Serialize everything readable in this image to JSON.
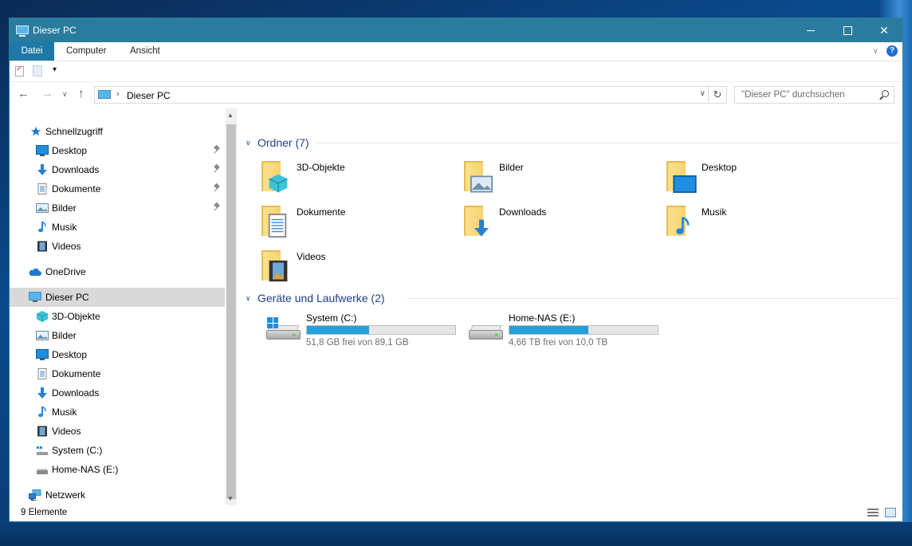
{
  "window": {
    "title": "Dieser PC"
  },
  "ribbon": {
    "tabs": [
      "Datei",
      "Computer",
      "Ansicht"
    ],
    "help": "?"
  },
  "address": {
    "path": "Dieser PC",
    "search_placeholder": "\"Dieser PC\" durchsuchen"
  },
  "nav": {
    "quick_access": "Schnellzugriff",
    "quick_items": [
      "Desktop",
      "Downloads",
      "Dokumente",
      "Bilder",
      "Musik",
      "Videos"
    ],
    "onedrive": "OneDrive",
    "this_pc": "Dieser PC",
    "pc_items": [
      "3D-Objekte",
      "Bilder",
      "Desktop",
      "Dokumente",
      "Downloads",
      "Musik",
      "Videos",
      "System (C:)",
      "Home-NAS (E:)"
    ],
    "network": "Netzwerk"
  },
  "content": {
    "folders_header": "Ordner (7)",
    "folders": [
      "3D-Objekte",
      "Bilder",
      "Desktop",
      "Dokumente",
      "Downloads",
      "Musik",
      "Videos"
    ],
    "devices_header": "Geräte und Laufwerke (2)",
    "drives": [
      {
        "name": "System (C:)",
        "free_text": "51,8 GB frei von 89,1 GB",
        "used_fraction": 0.42
      },
      {
        "name": "Home-NAS (E:)",
        "free_text": "4,66 TB frei von 10,0 TB",
        "used_fraction": 0.53
      }
    ]
  },
  "status": {
    "items": "9 Elemente"
  },
  "colors": {
    "titlebar": "#2a7c9e",
    "accent": "#26a0da",
    "selection": "#d9d9d9",
    "group_header": "#1e3f8a"
  }
}
